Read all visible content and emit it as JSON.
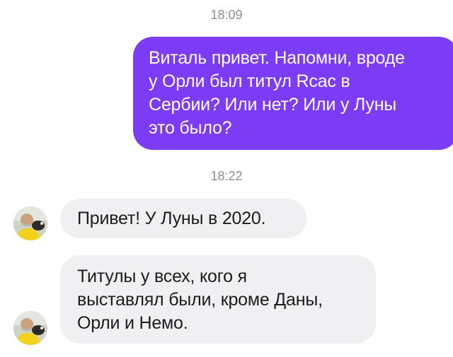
{
  "chat": {
    "timestamp_1": "18:09",
    "timestamp_2": "18:22",
    "outgoing_message": {
      "lines": [
        "Виталь привет. Напомни, вроде",
        "у Орли был титул Rcac в",
        "Сербии? Или нет? Или у Луны",
        "это было?"
      ]
    },
    "incoming_messages": [
      {
        "lines": [
          "Привет! У Луны в 2020."
        ]
      },
      {
        "lines": [
          "Титулы у всех, кого я",
          "выставлял были, кроме Даны,",
          "Орли и Немо."
        ]
      }
    ],
    "avatar_icon": "contact-photo",
    "colors": {
      "outgoing_bubble": "#7c3cf5",
      "incoming_bubble": "#f0f0f3",
      "timestamp": "#8e8e93"
    }
  }
}
